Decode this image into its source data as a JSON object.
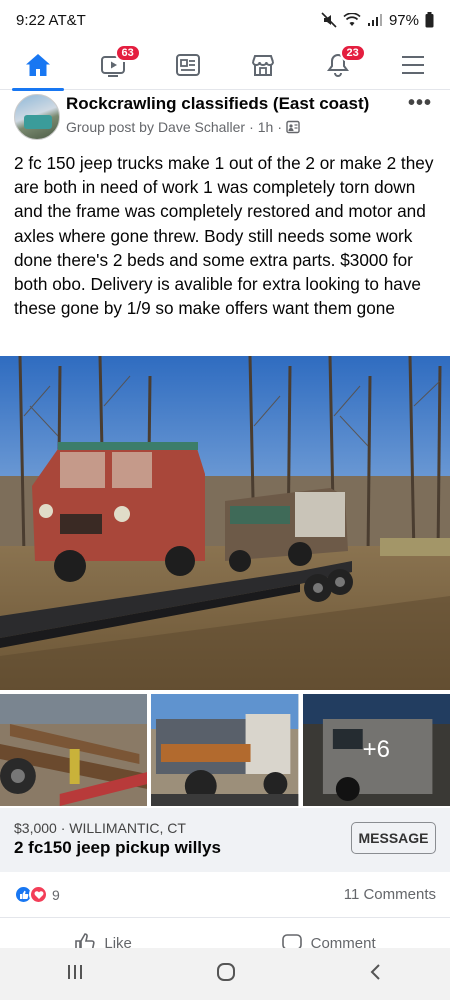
{
  "status_bar": {
    "time": "9:22",
    "carrier": "AT&T",
    "battery": "97%"
  },
  "nav": {
    "items": [
      {
        "name": "home",
        "active": true
      },
      {
        "name": "watch",
        "badge": "63"
      },
      {
        "name": "news",
        "badge": ""
      },
      {
        "name": "marketplace",
        "badge": ""
      },
      {
        "name": "notifications",
        "badge": "23"
      },
      {
        "name": "menu",
        "badge": ""
      }
    ]
  },
  "post": {
    "group_name": "Rockcrawling classifieds (East coast)",
    "meta_prefix": "Group post by",
    "author": "Dave Schaller",
    "separator": "·",
    "time_ago": "1h",
    "more": "•••",
    "body": "2 fc 150 jeep trucks make 1 out of the 2 or make 2 they are both in need of work 1 was completely torn down and the frame was completely restored and motor and axles where gone threw. Body still needs some work done there's 2 beds and some extra parts. $3000 for both obo. Delivery is avalible for extra looking to have these gone by 1/9 so make offers want them gone",
    "more_photos": "+6"
  },
  "listing": {
    "price_location": "$3,000 · WILLIMANTIC, CT",
    "title": "2 fc150 jeep pickup willys",
    "message_label": "MESSAGE"
  },
  "reactions": {
    "count": "9",
    "comments": "11 Comments"
  },
  "actions": {
    "like": "Like",
    "comment": "Comment"
  },
  "colors": {
    "accent": "#1877f2",
    "badge": "#e41e3f",
    "love": "#f33e58"
  }
}
